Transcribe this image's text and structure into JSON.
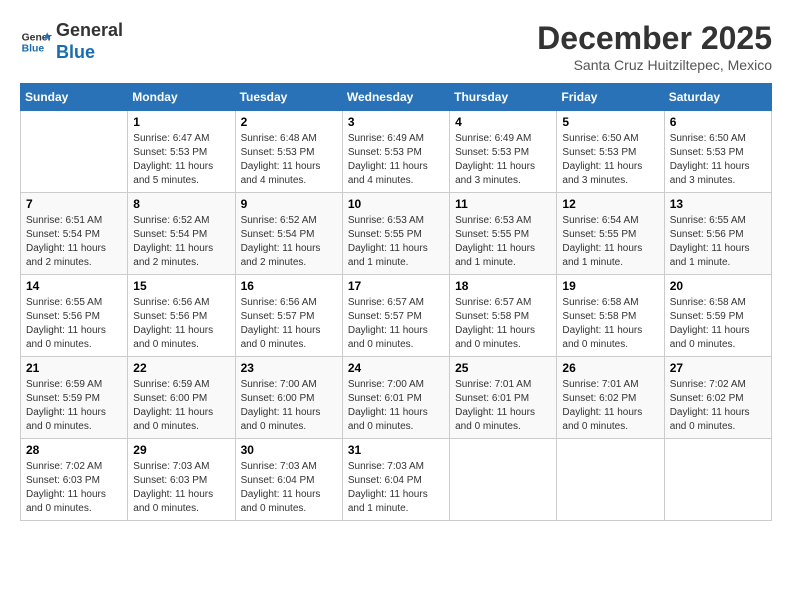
{
  "header": {
    "logo_line1": "General",
    "logo_line2": "Blue",
    "month_title": "December 2025",
    "subtitle": "Santa Cruz Huitziltepec, Mexico"
  },
  "weekdays": [
    "Sunday",
    "Monday",
    "Tuesday",
    "Wednesday",
    "Thursday",
    "Friday",
    "Saturday"
  ],
  "weeks": [
    [
      {
        "day": "",
        "sunrise": "",
        "sunset": "",
        "daylight": ""
      },
      {
        "day": "1",
        "sunrise": "Sunrise: 6:47 AM",
        "sunset": "Sunset: 5:53 PM",
        "daylight": "Daylight: 11 hours and 5 minutes."
      },
      {
        "day": "2",
        "sunrise": "Sunrise: 6:48 AM",
        "sunset": "Sunset: 5:53 PM",
        "daylight": "Daylight: 11 hours and 4 minutes."
      },
      {
        "day": "3",
        "sunrise": "Sunrise: 6:49 AM",
        "sunset": "Sunset: 5:53 PM",
        "daylight": "Daylight: 11 hours and 4 minutes."
      },
      {
        "day": "4",
        "sunrise": "Sunrise: 6:49 AM",
        "sunset": "Sunset: 5:53 PM",
        "daylight": "Daylight: 11 hours and 3 minutes."
      },
      {
        "day": "5",
        "sunrise": "Sunrise: 6:50 AM",
        "sunset": "Sunset: 5:53 PM",
        "daylight": "Daylight: 11 hours and 3 minutes."
      },
      {
        "day": "6",
        "sunrise": "Sunrise: 6:50 AM",
        "sunset": "Sunset: 5:53 PM",
        "daylight": "Daylight: 11 hours and 3 minutes."
      }
    ],
    [
      {
        "day": "7",
        "sunrise": "Sunrise: 6:51 AM",
        "sunset": "Sunset: 5:54 PM",
        "daylight": "Daylight: 11 hours and 2 minutes."
      },
      {
        "day": "8",
        "sunrise": "Sunrise: 6:52 AM",
        "sunset": "Sunset: 5:54 PM",
        "daylight": "Daylight: 11 hours and 2 minutes."
      },
      {
        "day": "9",
        "sunrise": "Sunrise: 6:52 AM",
        "sunset": "Sunset: 5:54 PM",
        "daylight": "Daylight: 11 hours and 2 minutes."
      },
      {
        "day": "10",
        "sunrise": "Sunrise: 6:53 AM",
        "sunset": "Sunset: 5:55 PM",
        "daylight": "Daylight: 11 hours and 1 minute."
      },
      {
        "day": "11",
        "sunrise": "Sunrise: 6:53 AM",
        "sunset": "Sunset: 5:55 PM",
        "daylight": "Daylight: 11 hours and 1 minute."
      },
      {
        "day": "12",
        "sunrise": "Sunrise: 6:54 AM",
        "sunset": "Sunset: 5:55 PM",
        "daylight": "Daylight: 11 hours and 1 minute."
      },
      {
        "day": "13",
        "sunrise": "Sunrise: 6:55 AM",
        "sunset": "Sunset: 5:56 PM",
        "daylight": "Daylight: 11 hours and 1 minute."
      }
    ],
    [
      {
        "day": "14",
        "sunrise": "Sunrise: 6:55 AM",
        "sunset": "Sunset: 5:56 PM",
        "daylight": "Daylight: 11 hours and 0 minutes."
      },
      {
        "day": "15",
        "sunrise": "Sunrise: 6:56 AM",
        "sunset": "Sunset: 5:56 PM",
        "daylight": "Daylight: 11 hours and 0 minutes."
      },
      {
        "day": "16",
        "sunrise": "Sunrise: 6:56 AM",
        "sunset": "Sunset: 5:57 PM",
        "daylight": "Daylight: 11 hours and 0 minutes."
      },
      {
        "day": "17",
        "sunrise": "Sunrise: 6:57 AM",
        "sunset": "Sunset: 5:57 PM",
        "daylight": "Daylight: 11 hours and 0 minutes."
      },
      {
        "day": "18",
        "sunrise": "Sunrise: 6:57 AM",
        "sunset": "Sunset: 5:58 PM",
        "daylight": "Daylight: 11 hours and 0 minutes."
      },
      {
        "day": "19",
        "sunrise": "Sunrise: 6:58 AM",
        "sunset": "Sunset: 5:58 PM",
        "daylight": "Daylight: 11 hours and 0 minutes."
      },
      {
        "day": "20",
        "sunrise": "Sunrise: 6:58 AM",
        "sunset": "Sunset: 5:59 PM",
        "daylight": "Daylight: 11 hours and 0 minutes."
      }
    ],
    [
      {
        "day": "21",
        "sunrise": "Sunrise: 6:59 AM",
        "sunset": "Sunset: 5:59 PM",
        "daylight": "Daylight: 11 hours and 0 minutes."
      },
      {
        "day": "22",
        "sunrise": "Sunrise: 6:59 AM",
        "sunset": "Sunset: 6:00 PM",
        "daylight": "Daylight: 11 hours and 0 minutes."
      },
      {
        "day": "23",
        "sunrise": "Sunrise: 7:00 AM",
        "sunset": "Sunset: 6:00 PM",
        "daylight": "Daylight: 11 hours and 0 minutes."
      },
      {
        "day": "24",
        "sunrise": "Sunrise: 7:00 AM",
        "sunset": "Sunset: 6:01 PM",
        "daylight": "Daylight: 11 hours and 0 minutes."
      },
      {
        "day": "25",
        "sunrise": "Sunrise: 7:01 AM",
        "sunset": "Sunset: 6:01 PM",
        "daylight": "Daylight: 11 hours and 0 minutes."
      },
      {
        "day": "26",
        "sunrise": "Sunrise: 7:01 AM",
        "sunset": "Sunset: 6:02 PM",
        "daylight": "Daylight: 11 hours and 0 minutes."
      },
      {
        "day": "27",
        "sunrise": "Sunrise: 7:02 AM",
        "sunset": "Sunset: 6:02 PM",
        "daylight": "Daylight: 11 hours and 0 minutes."
      }
    ],
    [
      {
        "day": "28",
        "sunrise": "Sunrise: 7:02 AM",
        "sunset": "Sunset: 6:03 PM",
        "daylight": "Daylight: 11 hours and 0 minutes."
      },
      {
        "day": "29",
        "sunrise": "Sunrise: 7:03 AM",
        "sunset": "Sunset: 6:03 PM",
        "daylight": "Daylight: 11 hours and 0 minutes."
      },
      {
        "day": "30",
        "sunrise": "Sunrise: 7:03 AM",
        "sunset": "Sunset: 6:04 PM",
        "daylight": "Daylight: 11 hours and 0 minutes."
      },
      {
        "day": "31",
        "sunrise": "Sunrise: 7:03 AM",
        "sunset": "Sunset: 6:04 PM",
        "daylight": "Daylight: 11 hours and 1 minute."
      },
      {
        "day": "",
        "sunrise": "",
        "sunset": "",
        "daylight": ""
      },
      {
        "day": "",
        "sunrise": "",
        "sunset": "",
        "daylight": ""
      },
      {
        "day": "",
        "sunrise": "",
        "sunset": "",
        "daylight": ""
      }
    ]
  ]
}
